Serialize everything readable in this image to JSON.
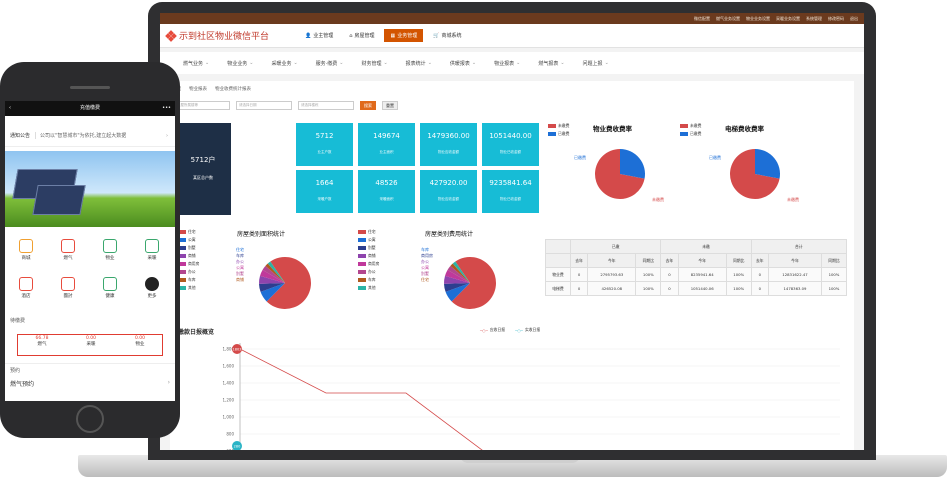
{
  "laptop": {
    "topbar_links": [
      "微信配置",
      "燃气业务设置",
      "物业业务设置",
      "采暖业务设置",
      "系统管理",
      "修改密码",
      "退出"
    ],
    "app_title": "示到社区物业微信平台",
    "nav_tabs": [
      {
        "label": "业主管理",
        "active": false
      },
      {
        "label": "房屋管理",
        "active": false
      },
      {
        "label": "业务管理",
        "active": true
      },
      {
        "label": "商城系统",
        "active": false
      }
    ],
    "menu": [
      "燃气业务",
      "物业业务",
      "采暖业务",
      "服务·缴费",
      "财务管理",
      "报表统计",
      "供暖报表",
      "物业报表",
      "燃气报表",
      "问题上报"
    ],
    "breadcrumb": [
      "管理",
      "物业报表",
      "物业收费统计报表"
    ],
    "filters": [
      "房屋所属楼等",
      "请选择日期",
      "请选择楼栋"
    ],
    "search_label": "搜索",
    "reset_label": "重置",
    "dark_box": {
      "value": "5712户",
      "label": "某区总户数"
    },
    "stats": [
      {
        "value": "5712",
        "label": "业主户数"
      },
      {
        "value": "149674",
        "label": "业主面积"
      },
      {
        "value": "1479360.00",
        "label": "物业应收金额"
      },
      {
        "value": "1051440.00",
        "label": "物业已收金额"
      },
      {
        "value": "1664",
        "label": "采暖户数"
      },
      {
        "value": "48526",
        "label": "采暖面积"
      },
      {
        "value": "427920.00",
        "label": "物业应收金额"
      },
      {
        "value": "9235841.64",
        "label": "物业已收金额"
      }
    ],
    "pie1": {
      "title": "物业费收费率",
      "legend": [
        "未缴费",
        "已缴费"
      ],
      "labels": [
        "已缴费",
        "未缴费"
      ],
      "colors": [
        "#d44a4a",
        "#1d6fd6"
      ],
      "unpaid_share": 0.72
    },
    "pie2": {
      "title": "电梯费收费率",
      "legend": [
        "未缴费",
        "已缴费"
      ],
      "labels": [
        "已缴费",
        "未缴费"
      ],
      "colors": [
        "#d44a4a",
        "#1d6fd6"
      ],
      "unpaid_share": 0.72
    },
    "area_chart": {
      "title": "房屋类别面积统计",
      "legend": [
        "住宅",
        "公寓",
        "别墅",
        "商铺",
        "商用房",
        "办公",
        "车库",
        "其他"
      ],
      "colors": [
        "#d44a4a",
        "#1d6fd6",
        "#2c3e8f",
        "#8e44ad",
        "#c0399b",
        "#b3478f",
        "#b05a1f",
        "#2ab4a6"
      ],
      "slice_labels": [
        "住宅",
        "车库",
        "办公",
        "公寓",
        "别墅",
        "商铺"
      ]
    },
    "fee_chart": {
      "title": "房屋类别费用统计",
      "legend": [
        "住宅",
        "公寓",
        "别墅",
        "商铺",
        "商用房",
        "办公",
        "车库",
        "其他"
      ],
      "colors": [
        "#d44a4a",
        "#1d6fd6",
        "#2c3e8f",
        "#8e44ad",
        "#c0399b",
        "#b3478f",
        "#b05a1f",
        "#2ab4a6"
      ],
      "slice_labels": [
        "车库",
        "商用房",
        "办公",
        "公寓",
        "别墅",
        "住宅"
      ]
    },
    "table": {
      "groups": [
        "已缴",
        "未缴",
        "合计"
      ],
      "sub": [
        "去年",
        "今年",
        "同期比"
      ],
      "rows": [
        {
          "name": "物业费",
          "cells": [
            "0",
            "2795793.63",
            "100%",
            "0",
            "8235941.64",
            "100%",
            "0",
            "12831622.47",
            "100%"
          ]
        },
        {
          "name": "电梯费",
          "cells": [
            "0",
            "426520.08",
            "100%",
            "0",
            "1051440.06",
            "100%",
            "0",
            "1478363.09",
            "100%"
          ]
        }
      ]
    },
    "line_chart": {
      "title": "缴款日报概览",
      "legend": [
        "应收日报",
        "实收日报"
      ],
      "colors": [
        "#d44a4a",
        "#2ab4c6"
      ],
      "yticks": [
        "1,800",
        "1,600",
        "1,400",
        "1,200",
        "1,000",
        "800",
        "600"
      ],
      "marker_top": "1803",
      "marker_bottom": "280"
    }
  },
  "phone": {
    "title": "充值缴费",
    "notice_label": "通知公告",
    "notice_text": "公司以\"智慧城市\"为依托,建立起大数据",
    "grid": [
      {
        "label": "商城",
        "color": "#f0a030"
      },
      {
        "label": "燃气",
        "color": "#e84c3d"
      },
      {
        "label": "物业",
        "color": "#3aa76d"
      },
      {
        "label": "采暖",
        "color": "#3aa76d"
      },
      {
        "label": "酒店",
        "color": "#e84c3d"
      },
      {
        "label": "團討",
        "color": "#e84c3d"
      },
      {
        "label": "健康",
        "color": "#3aa76d"
      },
      {
        "label": "更多",
        "color": "#222222"
      }
    ],
    "fee_section": "待缴费",
    "fees": [
      {
        "value": "66.78",
        "label": "燃气"
      },
      {
        "value": "0.00",
        "label": "采暖"
      },
      {
        "value": "0.00",
        "label": "物业"
      }
    ],
    "booking_section": "预约",
    "booking_item": "燃气预约"
  }
}
